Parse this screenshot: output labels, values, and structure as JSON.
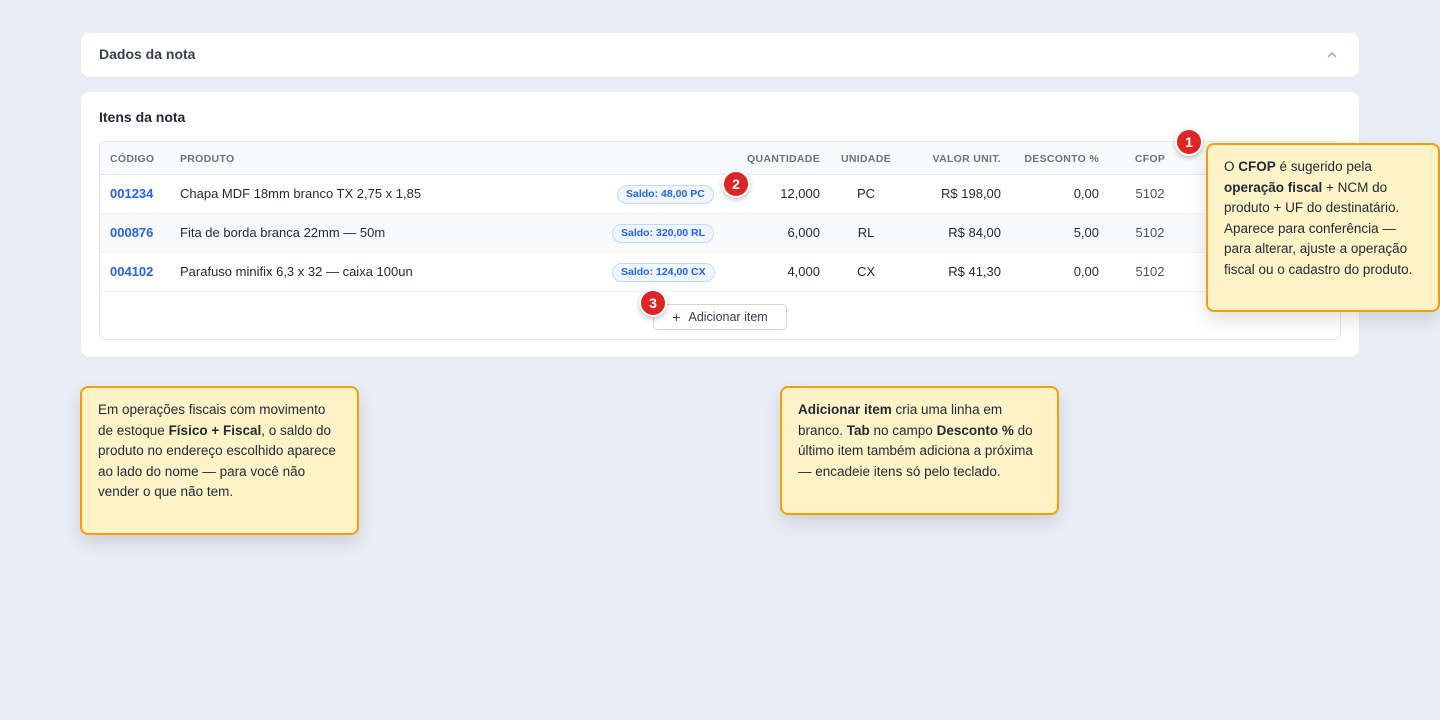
{
  "sections": {
    "dados": {
      "title": "Dados da nota"
    },
    "itens": {
      "title": "Itens da nota"
    }
  },
  "table": {
    "headers": {
      "codigo": "CÓDIGO",
      "produto": "PRODUTO",
      "quantidade": "QUANTIDADE",
      "unidade": "UNIDADE",
      "valor": "VALOR UNIT.",
      "desconto": "DESCONTO %",
      "cfop": "CFOP"
    },
    "rows": [
      {
        "codigo": "001234",
        "produto": "Chapa MDF 18mm branco TX 2,75 x 1,85",
        "saldo": "Saldo: 48,00 PC",
        "quantidade": "12,000",
        "unidade": "PC",
        "valor": "R$ 198,00",
        "desconto": "0,00",
        "cfop": "5102"
      },
      {
        "codigo": "000876",
        "produto": "Fita de borda branca 22mm — 50m",
        "saldo": "Saldo: 320,00 RL",
        "quantidade": "6,000",
        "unidade": "RL",
        "valor": "R$ 84,00",
        "desconto": "5,00",
        "cfop": "5102"
      },
      {
        "codigo": "004102",
        "produto": "Parafuso minifix 6,3 x 32 — caixa 100un",
        "saldo": "Saldo: 124,00 CX",
        "quantidade": "4,000",
        "unidade": "CX",
        "valor": "R$ 41,30",
        "desconto": "0,00",
        "cfop": "5102"
      }
    ],
    "add_button": {
      "label": "Adicionar item",
      "icon": "plus-icon"
    }
  },
  "markers": [
    "1",
    "2",
    "3"
  ],
  "callouts": {
    "cfop": {
      "p1": "O ",
      "b1": "CFOP",
      "p2": " é sugerido pela ",
      "b2": "operação fiscal",
      "p3": " + NCM do produto + UF do destinatário. Aparece para conferência — para alterar, ajuste a operação fiscal ou o cadastro do produto."
    },
    "saldo": {
      "p1": "Em operações fiscais com movimento de estoque ",
      "b1": "Físico + Fiscal",
      "p2": ", o saldo do produto no endereço escolhido aparece ao lado do nome — para você não vender o que não tem."
    },
    "adicionar": {
      "b1": "Adicionar item",
      "p1": " cria uma linha em branco. ",
      "b2": "Tab",
      "p2": " no campo ",
      "b3": "Desconto %",
      "p3": " do último item também adiciona a próxima — encadeie itens só pelo teclado."
    }
  },
  "colors": {
    "background": "#e9edf5",
    "link": "#2563eb",
    "callout_bg": "#fef3c7",
    "callout_border": "#f59e0b",
    "marker": "#dc2626"
  }
}
